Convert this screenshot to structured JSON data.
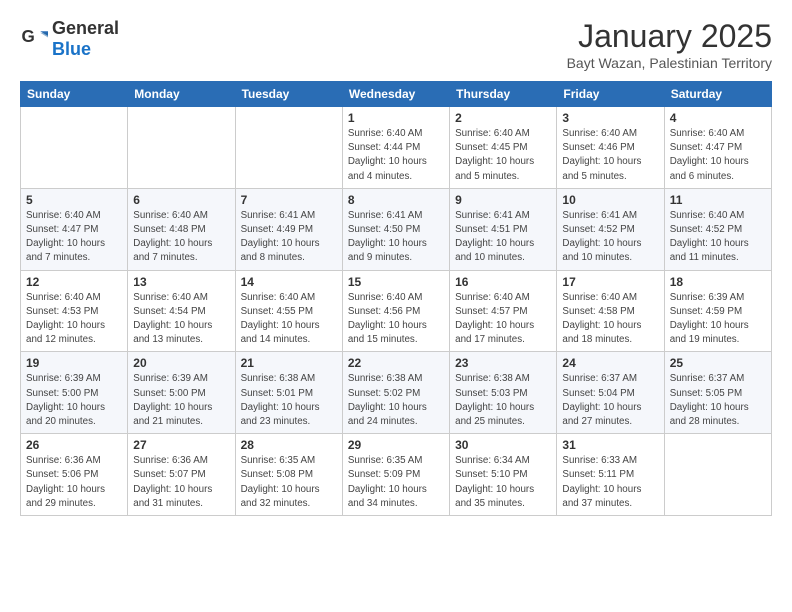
{
  "logo": {
    "general": "General",
    "blue": "Blue"
  },
  "header": {
    "title": "January 2025",
    "subtitle": "Bayt Wazan, Palestinian Territory"
  },
  "days_of_week": [
    "Sunday",
    "Monday",
    "Tuesday",
    "Wednesday",
    "Thursday",
    "Friday",
    "Saturday"
  ],
  "weeks": [
    [
      {
        "day": "",
        "info": ""
      },
      {
        "day": "",
        "info": ""
      },
      {
        "day": "",
        "info": ""
      },
      {
        "day": "1",
        "info": "Sunrise: 6:40 AM\nSunset: 4:44 PM\nDaylight: 10 hours\nand 4 minutes."
      },
      {
        "day": "2",
        "info": "Sunrise: 6:40 AM\nSunset: 4:45 PM\nDaylight: 10 hours\nand 5 minutes."
      },
      {
        "day": "3",
        "info": "Sunrise: 6:40 AM\nSunset: 4:46 PM\nDaylight: 10 hours\nand 5 minutes."
      },
      {
        "day": "4",
        "info": "Sunrise: 6:40 AM\nSunset: 4:47 PM\nDaylight: 10 hours\nand 6 minutes."
      }
    ],
    [
      {
        "day": "5",
        "info": "Sunrise: 6:40 AM\nSunset: 4:47 PM\nDaylight: 10 hours\nand 7 minutes."
      },
      {
        "day": "6",
        "info": "Sunrise: 6:40 AM\nSunset: 4:48 PM\nDaylight: 10 hours\nand 7 minutes."
      },
      {
        "day": "7",
        "info": "Sunrise: 6:41 AM\nSunset: 4:49 PM\nDaylight: 10 hours\nand 8 minutes."
      },
      {
        "day": "8",
        "info": "Sunrise: 6:41 AM\nSunset: 4:50 PM\nDaylight: 10 hours\nand 9 minutes."
      },
      {
        "day": "9",
        "info": "Sunrise: 6:41 AM\nSunset: 4:51 PM\nDaylight: 10 hours\nand 10 minutes."
      },
      {
        "day": "10",
        "info": "Sunrise: 6:41 AM\nSunset: 4:52 PM\nDaylight: 10 hours\nand 10 minutes."
      },
      {
        "day": "11",
        "info": "Sunrise: 6:40 AM\nSunset: 4:52 PM\nDaylight: 10 hours\nand 11 minutes."
      }
    ],
    [
      {
        "day": "12",
        "info": "Sunrise: 6:40 AM\nSunset: 4:53 PM\nDaylight: 10 hours\nand 12 minutes."
      },
      {
        "day": "13",
        "info": "Sunrise: 6:40 AM\nSunset: 4:54 PM\nDaylight: 10 hours\nand 13 minutes."
      },
      {
        "day": "14",
        "info": "Sunrise: 6:40 AM\nSunset: 4:55 PM\nDaylight: 10 hours\nand 14 minutes."
      },
      {
        "day": "15",
        "info": "Sunrise: 6:40 AM\nSunset: 4:56 PM\nDaylight: 10 hours\nand 15 minutes."
      },
      {
        "day": "16",
        "info": "Sunrise: 6:40 AM\nSunset: 4:57 PM\nDaylight: 10 hours\nand 17 minutes."
      },
      {
        "day": "17",
        "info": "Sunrise: 6:40 AM\nSunset: 4:58 PM\nDaylight: 10 hours\nand 18 minutes."
      },
      {
        "day": "18",
        "info": "Sunrise: 6:39 AM\nSunset: 4:59 PM\nDaylight: 10 hours\nand 19 minutes."
      }
    ],
    [
      {
        "day": "19",
        "info": "Sunrise: 6:39 AM\nSunset: 5:00 PM\nDaylight: 10 hours\nand 20 minutes."
      },
      {
        "day": "20",
        "info": "Sunrise: 6:39 AM\nSunset: 5:00 PM\nDaylight: 10 hours\nand 21 minutes."
      },
      {
        "day": "21",
        "info": "Sunrise: 6:38 AM\nSunset: 5:01 PM\nDaylight: 10 hours\nand 23 minutes."
      },
      {
        "day": "22",
        "info": "Sunrise: 6:38 AM\nSunset: 5:02 PM\nDaylight: 10 hours\nand 24 minutes."
      },
      {
        "day": "23",
        "info": "Sunrise: 6:38 AM\nSunset: 5:03 PM\nDaylight: 10 hours\nand 25 minutes."
      },
      {
        "day": "24",
        "info": "Sunrise: 6:37 AM\nSunset: 5:04 PM\nDaylight: 10 hours\nand 27 minutes."
      },
      {
        "day": "25",
        "info": "Sunrise: 6:37 AM\nSunset: 5:05 PM\nDaylight: 10 hours\nand 28 minutes."
      }
    ],
    [
      {
        "day": "26",
        "info": "Sunrise: 6:36 AM\nSunset: 5:06 PM\nDaylight: 10 hours\nand 29 minutes."
      },
      {
        "day": "27",
        "info": "Sunrise: 6:36 AM\nSunset: 5:07 PM\nDaylight: 10 hours\nand 31 minutes."
      },
      {
        "day": "28",
        "info": "Sunrise: 6:35 AM\nSunset: 5:08 PM\nDaylight: 10 hours\nand 32 minutes."
      },
      {
        "day": "29",
        "info": "Sunrise: 6:35 AM\nSunset: 5:09 PM\nDaylight: 10 hours\nand 34 minutes."
      },
      {
        "day": "30",
        "info": "Sunrise: 6:34 AM\nSunset: 5:10 PM\nDaylight: 10 hours\nand 35 minutes."
      },
      {
        "day": "31",
        "info": "Sunrise: 6:33 AM\nSunset: 5:11 PM\nDaylight: 10 hours\nand 37 minutes."
      },
      {
        "day": "",
        "info": ""
      }
    ]
  ]
}
